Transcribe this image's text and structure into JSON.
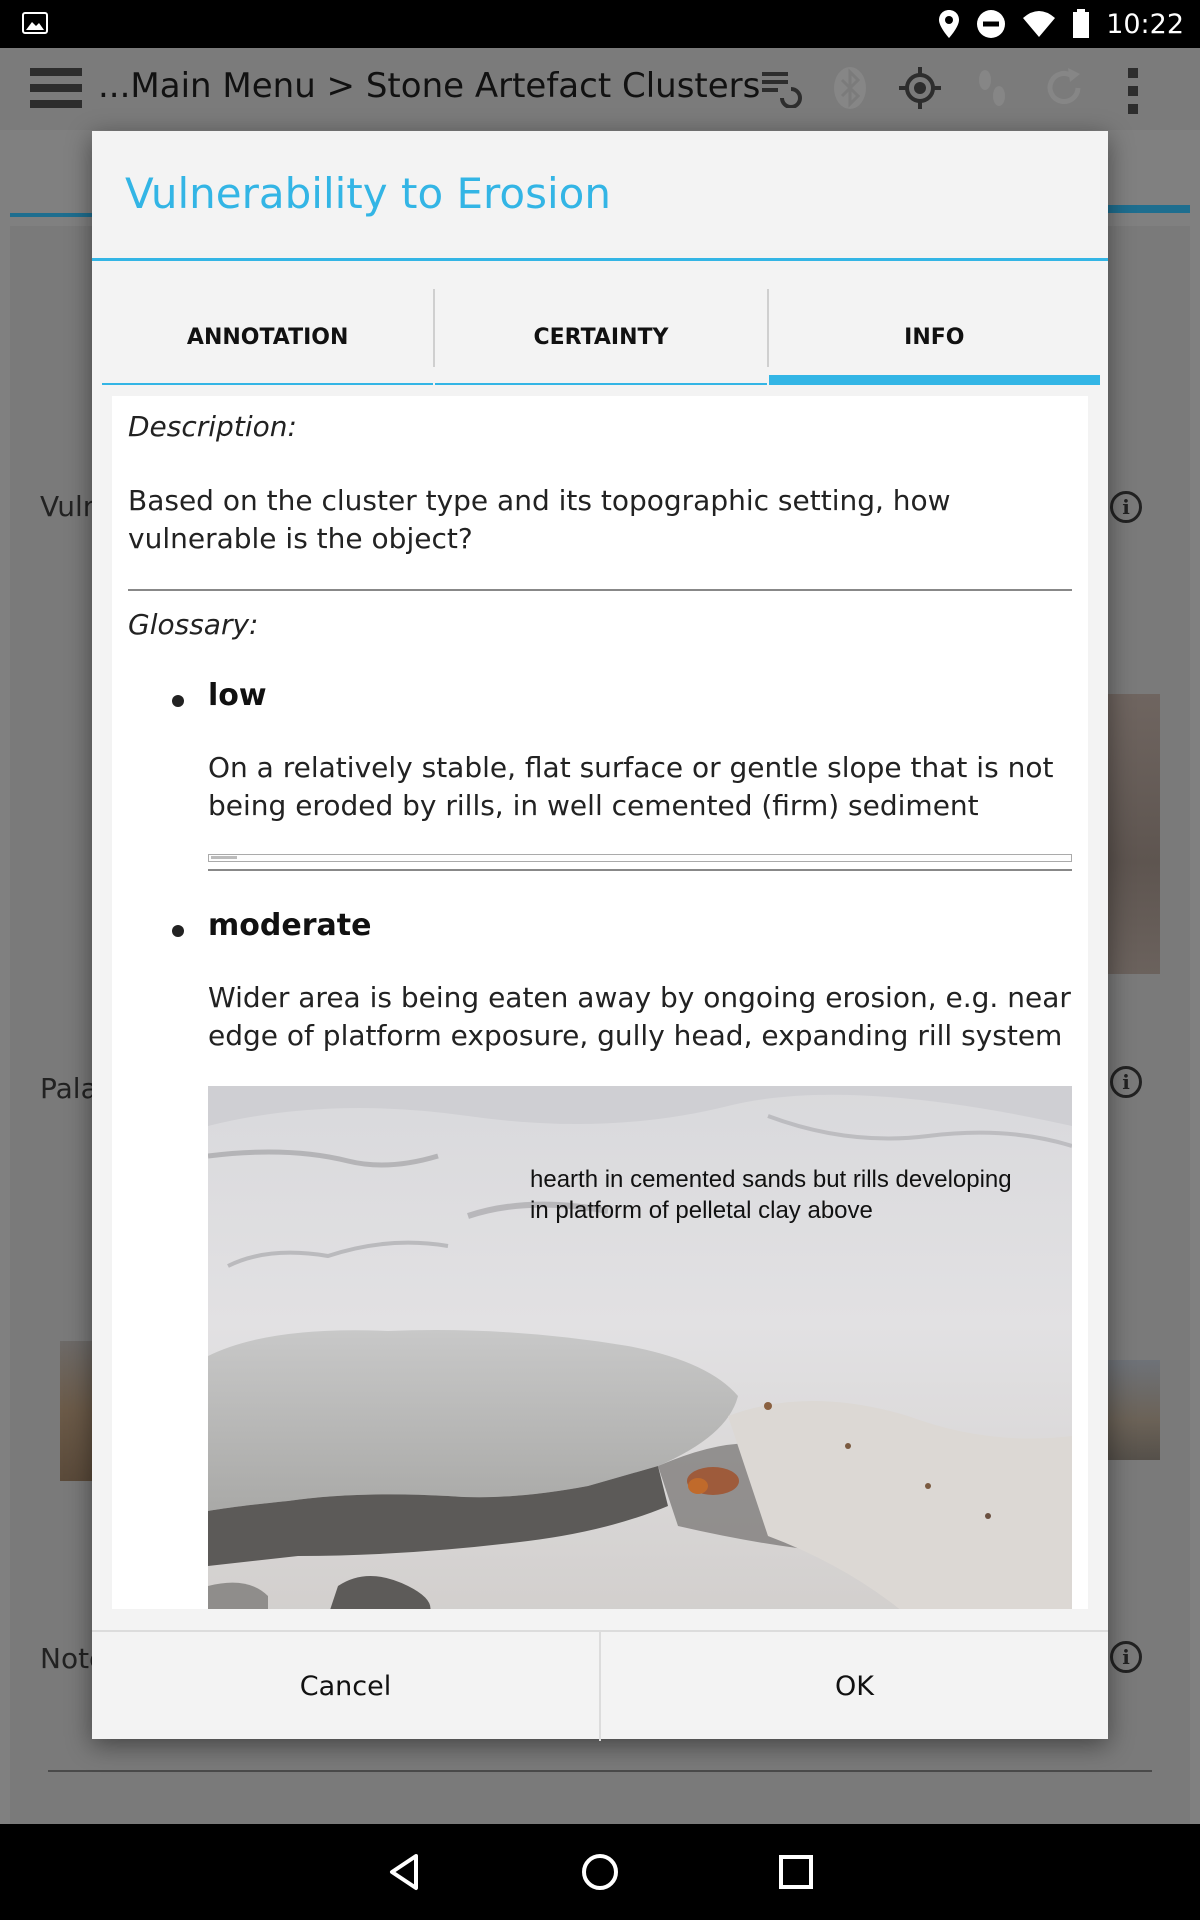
{
  "status_bar": {
    "time": "10:22",
    "icons": [
      "image-icon",
      "location-icon",
      "do-not-disturb-icon",
      "wifi-icon",
      "battery-icon"
    ]
  },
  "app_bar": {
    "breadcrumb": "...Main Menu > Stone Artefact Clusters",
    "icons": [
      "menu-icon",
      "sync-icon",
      "bluetooth-icon",
      "gps-icon",
      "tracking-icon",
      "refresh-icon",
      "overflow-menu-icon"
    ]
  },
  "background_form": {
    "labels": [
      "Vulnerability to Erosion",
      "Palaeosurface",
      "Notes"
    ]
  },
  "dialog": {
    "title": "Vulnerability to Erosion",
    "tabs": [
      {
        "label": "ANNOTATION",
        "active": false
      },
      {
        "label": "CERTAINTY",
        "active": false
      },
      {
        "label": "INFO",
        "active": true
      }
    ],
    "info": {
      "description_label": "Description:",
      "description": "Based on the cluster type and its topographic setting, how vulnerable is the object?",
      "glossary_label": "Glossary:",
      "glossary": [
        {
          "term": "low",
          "definition": "On a relatively stable, flat surface or gentle slope that is not being eroded by rills, in well cemented (firm) sediment"
        },
        {
          "term": "moderate",
          "definition": "Wider area is being eaten away by ongoing erosion, e.g. near edge of platform exposure, gully head, expanding rill system"
        }
      ],
      "photo_caption": [
        "hearth in cemented sands but rills developing",
        "in platform of pelletal clay above"
      ]
    },
    "buttons": {
      "cancel": "Cancel",
      "ok": "OK"
    }
  },
  "colors": {
    "accent": "#33b5e5",
    "scrim_background": "#808080",
    "dialog_background": "#f3f3f3"
  }
}
